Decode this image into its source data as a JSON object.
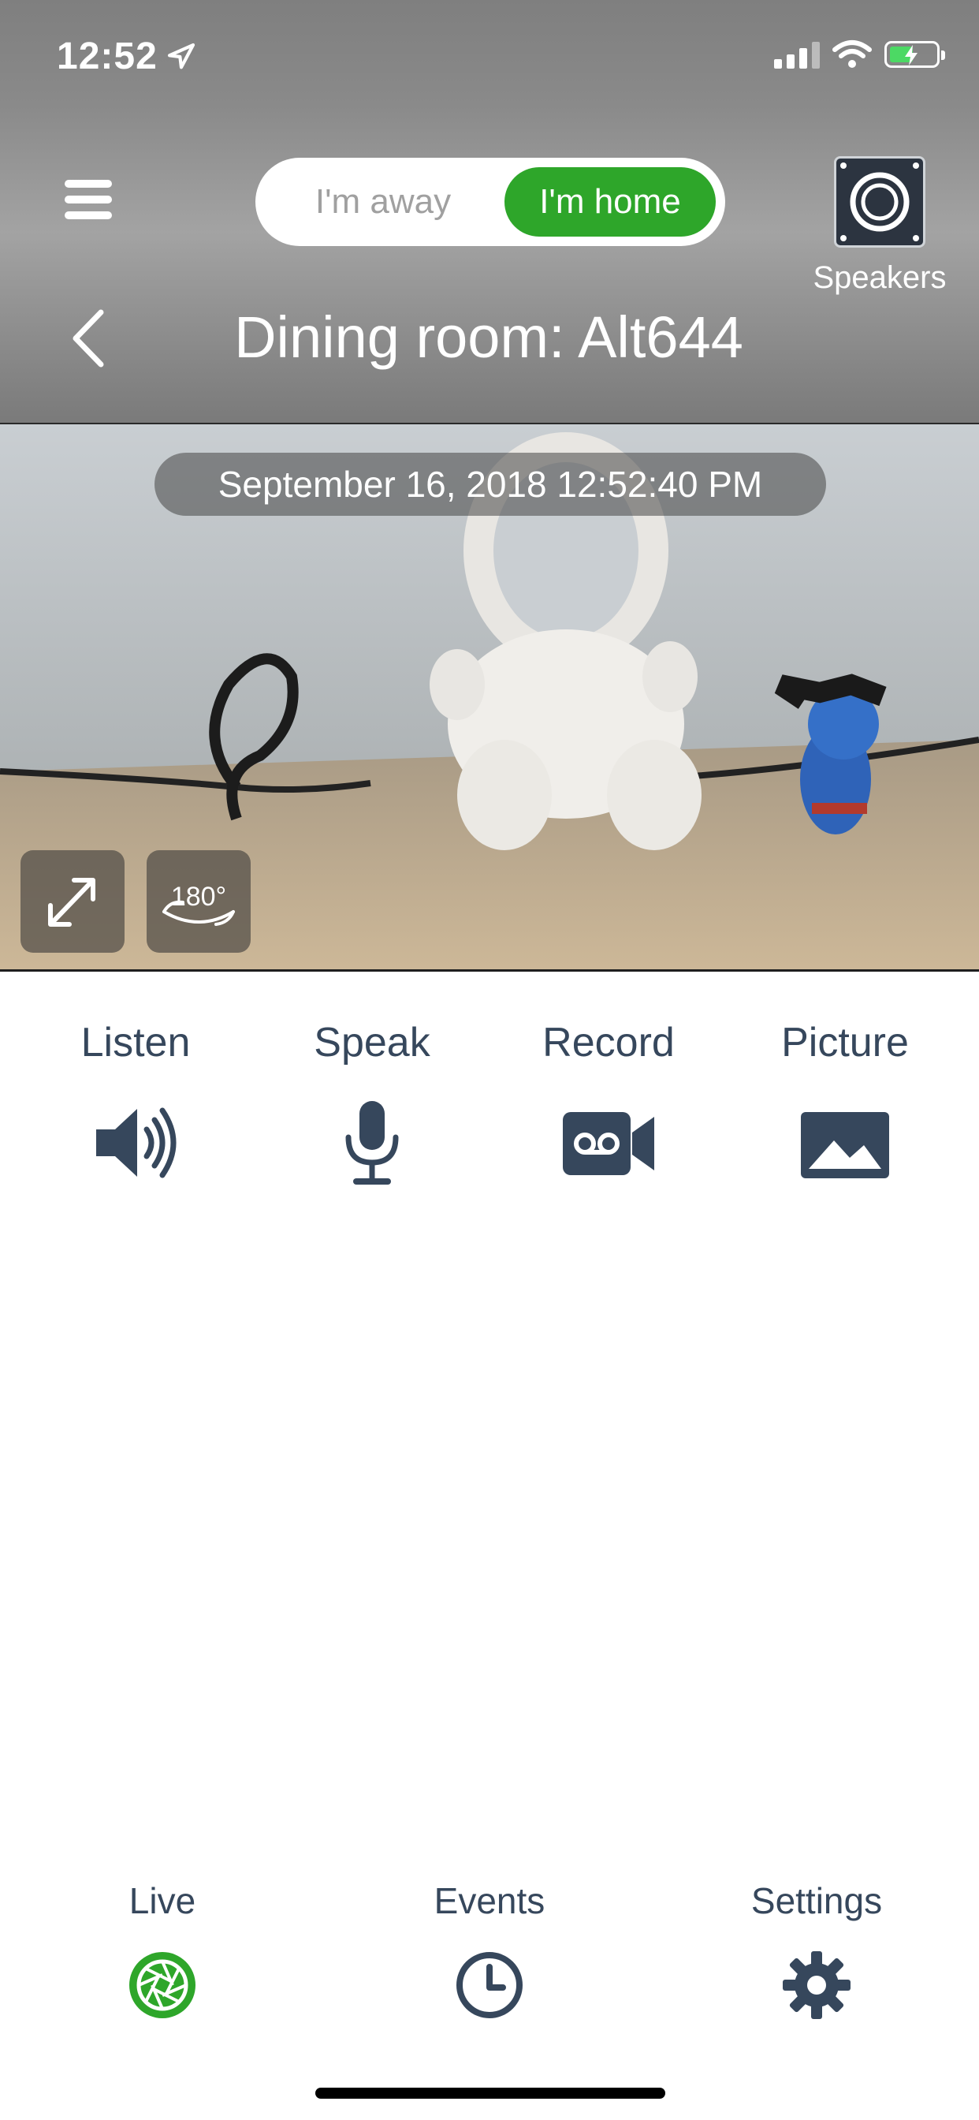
{
  "status_bar": {
    "time": "12:52"
  },
  "header": {
    "mode_toggle": {
      "away_label": "I'm away",
      "home_label": "I'm home",
      "selected": "home"
    },
    "speakers_label": "Speakers",
    "title": "Dining room: Alt644"
  },
  "camera": {
    "timestamp": "September 16, 2018  12:52:40 PM",
    "rotate_badge": "180°"
  },
  "actions": [
    {
      "label": "Listen",
      "icon": "speaker-volume-icon"
    },
    {
      "label": "Speak",
      "icon": "microphone-icon"
    },
    {
      "label": "Record",
      "icon": "video-record-icon"
    },
    {
      "label": "Picture",
      "icon": "picture-icon"
    }
  ],
  "tab_bar": [
    {
      "label": "Live",
      "icon": "live-camera-shutter-icon",
      "active": true
    },
    {
      "label": "Events",
      "icon": "clock-icon",
      "active": false
    },
    {
      "label": "Settings",
      "icon": "gear-icon",
      "active": false
    }
  ],
  "colors": {
    "accent": "#2ea62a",
    "text": "#36475c",
    "header_gray": "#8c8c8c"
  }
}
